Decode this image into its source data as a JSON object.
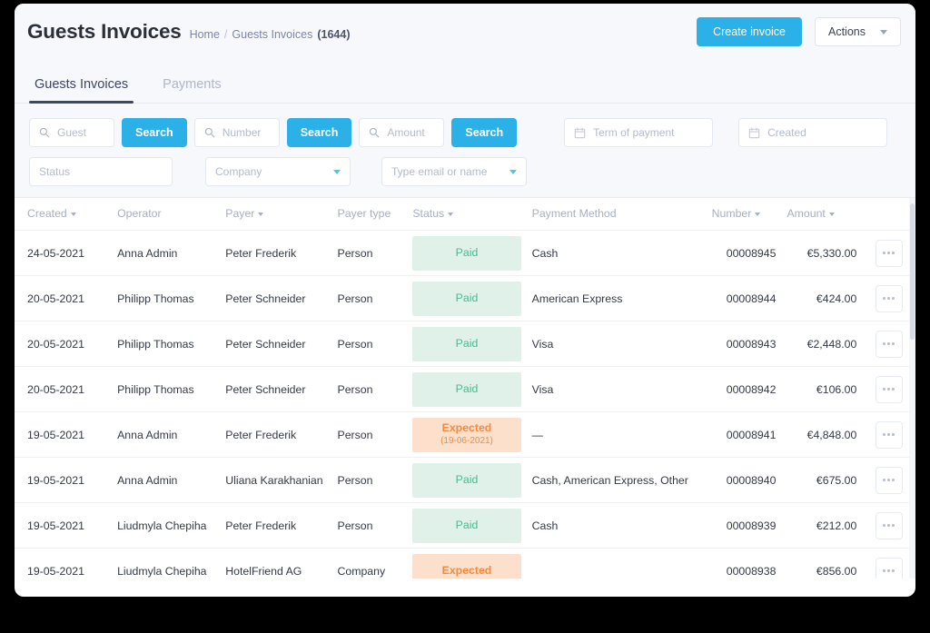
{
  "header": {
    "title": "Guests Invoices",
    "breadcrumb": {
      "home": "Home",
      "separator": "/",
      "current": "Guests Invoices",
      "count": "(1644)"
    },
    "create_button": "Create invoice",
    "actions_button": "Actions"
  },
  "tabs": [
    {
      "label": "Guests Invoices",
      "active": true
    },
    {
      "label": "Payments",
      "active": false
    }
  ],
  "filters": {
    "guest_placeholder": "Guest",
    "guest_value": "",
    "search_guest_label": "Search",
    "number_placeholder": "Number",
    "number_value": "",
    "search_number_label": "Search",
    "amount_placeholder": "Amount",
    "amount_value": "",
    "search_amount_label": "Search",
    "term_of_payment_placeholder": "Term of payment",
    "term_of_payment_value": "",
    "created_placeholder": "Created",
    "created_value": "",
    "status_placeholder": "Status",
    "status_value": "",
    "company_placeholder": "Company",
    "company_value": "",
    "email_or_name_placeholder": "Type email or name",
    "email_or_name_value": ""
  },
  "table": {
    "columns": [
      {
        "label": "Created",
        "sortable": true
      },
      {
        "label": "Operator",
        "sortable": false
      },
      {
        "label": "Payer",
        "sortable": true
      },
      {
        "label": "Payer type",
        "sortable": false
      },
      {
        "label": "Status",
        "sortable": true
      },
      {
        "label": "Payment Method",
        "sortable": false
      },
      {
        "label": "Number",
        "sortable": true
      },
      {
        "label": "Amount",
        "sortable": true
      }
    ],
    "rows": [
      {
        "created": "24-05-2021",
        "operator": "Anna Admin",
        "payer": "Peter Frederik",
        "payer_type": "Person",
        "status": "Paid",
        "status_kind": "paid",
        "status_sub": "",
        "method": "Cash",
        "number": "00008945",
        "amount": "€5,330.00"
      },
      {
        "created": "20-05-2021",
        "operator": "Philipp Thomas",
        "payer": "Peter Schneider",
        "payer_type": "Person",
        "status": "Paid",
        "status_kind": "paid",
        "status_sub": "",
        "method": "American Express",
        "number": "00008944",
        "amount": "€424.00"
      },
      {
        "created": "20-05-2021",
        "operator": "Philipp Thomas",
        "payer": "Peter Schneider",
        "payer_type": "Person",
        "status": "Paid",
        "status_kind": "paid",
        "status_sub": "",
        "method": "Visa",
        "number": "00008943",
        "amount": "€2,448.00"
      },
      {
        "created": "20-05-2021",
        "operator": "Philipp Thomas",
        "payer": "Peter Schneider",
        "payer_type": "Person",
        "status": "Paid",
        "status_kind": "paid",
        "status_sub": "",
        "method": "Visa",
        "number": "00008942",
        "amount": "€106.00"
      },
      {
        "created": "19-05-2021",
        "operator": "Anna Admin",
        "payer": "Peter Frederik",
        "payer_type": "Person",
        "status": "Expected",
        "status_kind": "expected",
        "status_sub": "(19-06-2021)",
        "method": "—",
        "number": "00008941",
        "amount": "€4,848.00"
      },
      {
        "created": "19-05-2021",
        "operator": "Anna Admin",
        "payer": "Uliana Karakhanian",
        "payer_type": "Person",
        "status": "Paid",
        "status_kind": "paid",
        "status_sub": "",
        "method": "Cash, American Express, Other",
        "number": "00008940",
        "amount": "€675.00"
      },
      {
        "created": "19-05-2021",
        "operator": "Liudmyla Chepiha",
        "payer": "Peter Frederik",
        "payer_type": "Person",
        "status": "Paid",
        "status_kind": "paid",
        "status_sub": "",
        "method": "Cash",
        "number": "00008939",
        "amount": "€212.00"
      },
      {
        "created": "19-05-2021",
        "operator": "Liudmyla Chepiha",
        "payer": "HotelFriend AG",
        "payer_type": "Company",
        "status": "Expected",
        "status_kind": "expected",
        "status_sub": "",
        "method": "",
        "number": "00008938",
        "amount": "€856.00"
      }
    ],
    "row_menu_icon": "kebab-icon"
  },
  "colors": {
    "accent": "#2cb0e8",
    "paid_bg": "#dff1e8",
    "paid_text": "#48bb8e",
    "expected_bg": "#fde0cb",
    "expected_text": "#f7893b",
    "tab_active": "#3d4663",
    "page_bg": "#f7f8fb"
  }
}
